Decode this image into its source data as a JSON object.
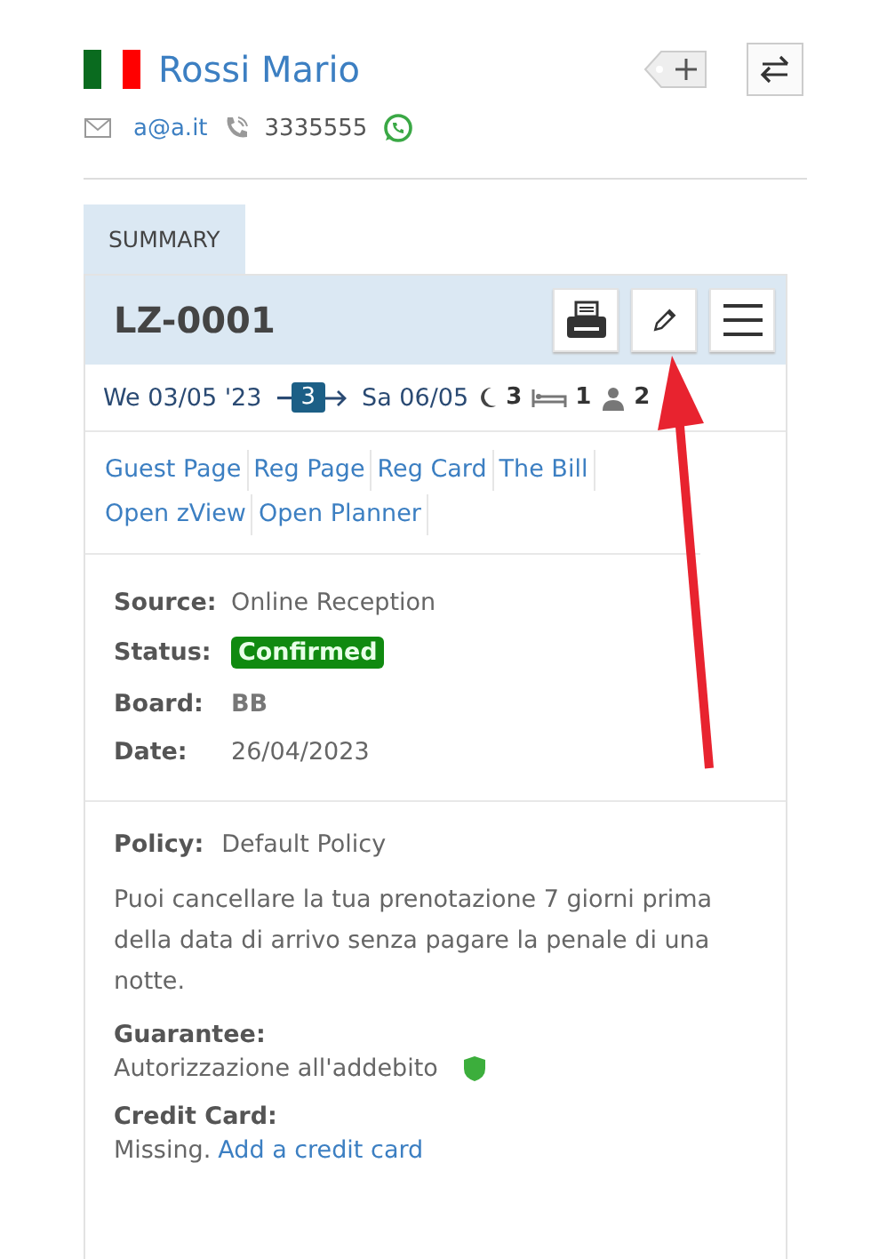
{
  "guest": {
    "name": "Rossi Mario",
    "email": "a@a.it",
    "phone": "3335555"
  },
  "tabs": [
    {
      "label": "SUMMARY",
      "selected": true
    }
  ],
  "booking": {
    "code": "LZ-0001",
    "arrival": "We 03/05 '23",
    "nights_badge": "3",
    "departure": "Sa 06/05",
    "nights": "3",
    "rooms": "1",
    "guests": "2"
  },
  "links": [
    {
      "label": "Guest Page"
    },
    {
      "label": "Reg Page"
    },
    {
      "label": "Reg Card"
    },
    {
      "label": "The Bill"
    },
    {
      "label": "Open zView"
    },
    {
      "label": "Open Planner"
    }
  ],
  "details": [
    {
      "label": "Source:",
      "value": "Online Reception",
      "kind": "text"
    },
    {
      "label": "Status:",
      "value": "Confirmed",
      "kind": "badge"
    },
    {
      "label": "Board:",
      "value": "BB",
      "kind": "bold"
    },
    {
      "label": "Date:",
      "value": "26/04/2023",
      "kind": "text"
    }
  ],
  "policy": {
    "label": "Policy:",
    "name": "Default Policy",
    "text": "Puoi cancellare la tua prenotazione 7 giorni prima della data di arrivo senza pagare la penale di una notte."
  },
  "guarantee": {
    "label": "Guarantee:",
    "value": "Autorizzazione all'addebito"
  },
  "credit_card": {
    "label": "Credit Card:",
    "value": "Missing.",
    "link": "Add a credit card"
  }
}
